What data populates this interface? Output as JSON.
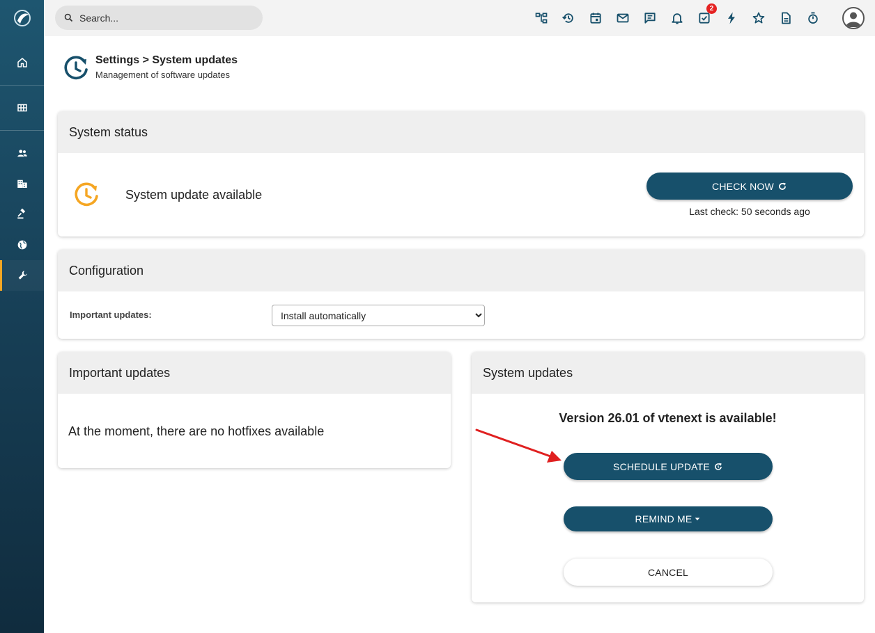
{
  "topbar": {
    "search_placeholder": "Search...",
    "icons": [
      "sitemap-icon",
      "history-icon",
      "calendar-icon",
      "mail-icon",
      "chat-icon",
      "bell-icon",
      "tasks-icon",
      "flash-icon",
      "star-icon",
      "document-icon",
      "timer-icon"
    ],
    "tasks_badge": "2"
  },
  "sidebar": {
    "items": [
      "home-icon",
      "grid-icon",
      "users-icon",
      "building-icon",
      "gavel-icon",
      "globe-icon",
      "wrench-icon"
    ],
    "active": "wrench-icon",
    "accent_color": "#f5a623"
  },
  "page": {
    "title": "Settings > System updates",
    "subtitle": "Management of software updates"
  },
  "system_status": {
    "heading": "System status",
    "message": "System update available",
    "check_button": "CHECK NOW",
    "last_check": "Last check: 50 seconds ago"
  },
  "configuration": {
    "heading": "Configuration",
    "label": "Important updates:",
    "selected_option": "Install automatically"
  },
  "important_updates": {
    "heading": "Important updates",
    "message": "At the moment, there are no hotfixes available"
  },
  "system_updates": {
    "heading": "System updates",
    "version_message": "Version 26.01 of vtenext is available!",
    "schedule_button": "SCHEDULE UPDATE",
    "remind_button": "REMIND ME",
    "cancel_button": "CANCEL"
  },
  "colors": {
    "primary": "#17506b",
    "warning": "#f5a623",
    "annotation_arrow": "#e02020"
  }
}
